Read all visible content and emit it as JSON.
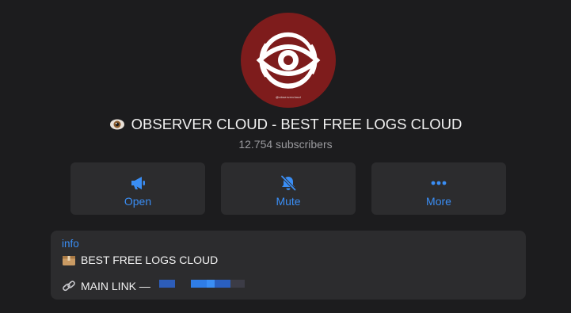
{
  "channel": {
    "avatar_caption": "@observercloud",
    "title": "OBSERVER CLOUD - BEST FREE LOGS CLOUD",
    "title_emoji": "eye-icon",
    "subscribers": "12.754 subscribers"
  },
  "actions": [
    {
      "label": "Open",
      "icon": "megaphone-icon"
    },
    {
      "label": "Mute",
      "icon": "bell-off-icon"
    },
    {
      "label": "More",
      "icon": "more-dots-icon"
    }
  ],
  "info": {
    "heading": "info",
    "line1_emoji": "package-icon",
    "line1_text": "BEST FREE LOGS CLOUD",
    "line2_emoji": "link-icon",
    "line2_text": "MAIN LINK —"
  },
  "colors": {
    "background": "#1c1c1e",
    "card": "#2c2c2e",
    "accent": "#3a8ef5",
    "avatar_red": "#7e1c1c",
    "text_primary": "#f2f2f2",
    "text_secondary": "#9a9a9e"
  }
}
